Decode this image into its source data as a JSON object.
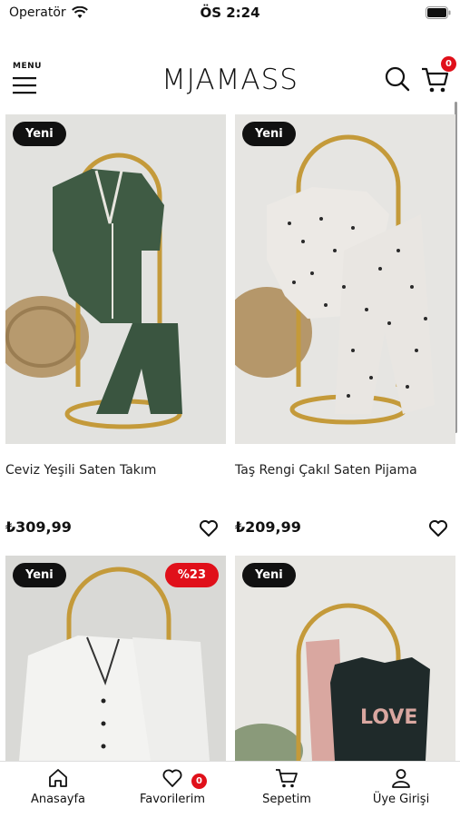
{
  "status": {
    "carrier": "Operatör",
    "time": "ÖS 2:24"
  },
  "header": {
    "menu_label": "MENU",
    "logo": "MJAMASS",
    "cart_count": "0"
  },
  "products": [
    {
      "name": "Ceviz Yeşili Saten Takım",
      "price": "₺309,99",
      "tag": "Yeni",
      "discount": ""
    },
    {
      "name": "Taş Rengi Çakıl Saten Pijama",
      "price": "₺209,99",
      "tag": "Yeni",
      "discount": ""
    },
    {
      "name": "",
      "price": "",
      "tag": "Yeni",
      "discount": "%23"
    },
    {
      "name": "",
      "price": "",
      "tag": "Yeni",
      "discount": ""
    }
  ],
  "photo_colors": {
    "bg1": "#e4e4e2",
    "green": "#3f5b44",
    "leopard": "#e9e6e2",
    "white": "#f3f3f1",
    "black": "#1f2a2a",
    "gold": "#c49a3a"
  },
  "tabbar": {
    "home": "Anasayfa",
    "favorites": "Favorilerim",
    "favorites_count": "0",
    "cart": "Sepetim",
    "login": "Üye Girişi"
  }
}
